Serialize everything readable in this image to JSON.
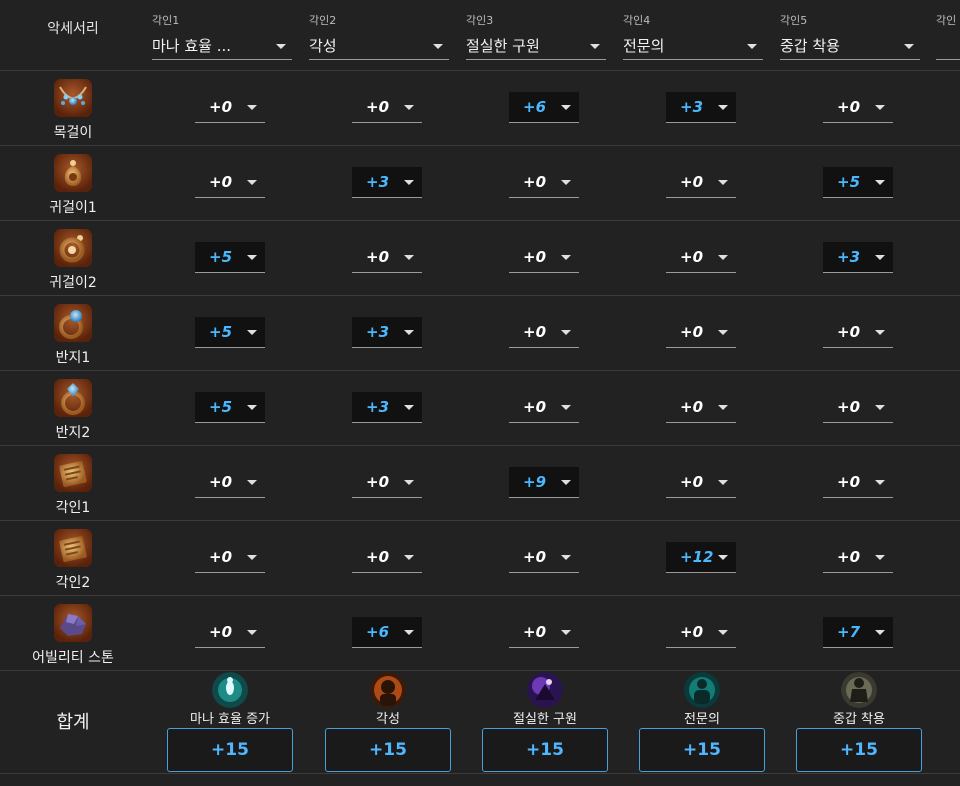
{
  "header": {
    "accessory_label": "악세서리",
    "engravings": [
      {
        "label": "각인1",
        "value": "마나 효율 ..."
      },
      {
        "label": "각인2",
        "value": "각성"
      },
      {
        "label": "각인3",
        "value": "절실한 구원"
      },
      {
        "label": "각인4",
        "value": "전문의"
      },
      {
        "label": "각인5",
        "value": "중갑 착용"
      },
      {
        "label": "각인",
        "value": ""
      }
    ]
  },
  "accessories": [
    {
      "name": "목걸이",
      "icon": "necklace-icon",
      "levels": [
        "+0",
        "+0",
        "+6",
        "+3",
        "+0"
      ]
    },
    {
      "name": "귀걸이1",
      "icon": "earring-icon",
      "levels": [
        "+0",
        "+3",
        "+0",
        "+0",
        "+5"
      ]
    },
    {
      "name": "귀걸이2",
      "icon": "earring-icon",
      "levels": [
        "+5",
        "+0",
        "+0",
        "+0",
        "+3"
      ]
    },
    {
      "name": "반지1",
      "icon": "ring-icon",
      "levels": [
        "+5",
        "+3",
        "+0",
        "+0",
        "+0"
      ]
    },
    {
      "name": "반지2",
      "icon": "ring-icon",
      "levels": [
        "+5",
        "+3",
        "+0",
        "+0",
        "+0"
      ]
    },
    {
      "name": "각인1",
      "icon": "engraving-book-icon",
      "levels": [
        "+0",
        "+0",
        "+9",
        "+0",
        "+0"
      ]
    },
    {
      "name": "각인2",
      "icon": "engraving-book-icon",
      "levels": [
        "+0",
        "+0",
        "+0",
        "+12",
        "+0"
      ]
    },
    {
      "name": "어빌리티 스톤",
      "icon": "ability-stone-icon",
      "levels": [
        "+0",
        "+6",
        "+0",
        "+0",
        "+7"
      ]
    }
  ],
  "totals": {
    "label": "합계",
    "items": [
      {
        "name": "마나 효율 증가",
        "icon": "mana-efficiency-icon",
        "value": "+15"
      },
      {
        "name": "각성",
        "icon": "awakening-icon",
        "value": "+15"
      },
      {
        "name": "절실한 구원",
        "icon": "desperate-salvation-icon",
        "value": "+15"
      },
      {
        "name": "전문의",
        "icon": "master-healer-icon",
        "value": "+15"
      },
      {
        "name": "중갑 착용",
        "icon": "heavy-armor-icon",
        "value": "+15"
      }
    ]
  },
  "colors": {
    "background": "#222222",
    "highlight_text": "#4ab8ff",
    "total_border": "#4a9fd8",
    "icon_frame": "#7a3210"
  }
}
